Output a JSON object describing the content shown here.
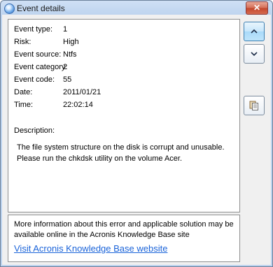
{
  "window": {
    "title": "Event details",
    "close_label": "✕"
  },
  "details": {
    "fields": [
      {
        "label": "Event type:",
        "value": "1"
      },
      {
        "label": "Risk:",
        "value": "High"
      },
      {
        "label": "Event source:",
        "value": "Ntfs"
      },
      {
        "label": "Event category:",
        "value": "2"
      },
      {
        "label": "Event code:",
        "value": "55"
      },
      {
        "label": "Date:",
        "value": "2011/01/21"
      },
      {
        "label": "Time:",
        "value": "22:02:14"
      }
    ],
    "description_label": "Description:",
    "description": "The file system structure on the disk is corrupt and unusable. Please run the chkdsk utility on the volume Acer."
  },
  "info": {
    "text": "More information about this error and applicable solution may be available online in the Acronis Knowledge Base site",
    "link": "Visit Acronis Knowledge Base website"
  },
  "side_buttons": {
    "previous": "chevron-up-icon",
    "next": "chevron-down-icon",
    "copy": "copy-to-clipboard-icon"
  }
}
